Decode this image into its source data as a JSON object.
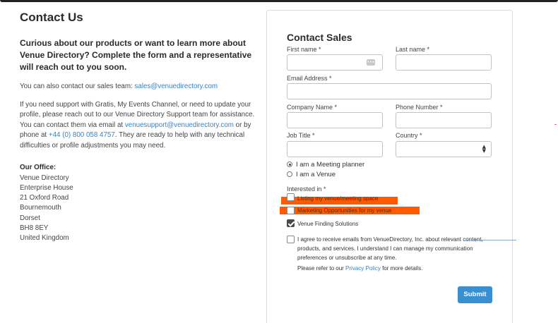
{
  "left": {
    "title": "Contact Us",
    "lead": "Curious about our products or want to learn more about Venue Directory? Complete the form and a representative will reach out to you soon.",
    "sales_prefix": "You can also contact our sales team: ",
    "sales_email": "sales@venuedirectory.com",
    "support_text_1": "If you need support with Gratis, My Events Channel, or need to update your profile, please reach out to our Venue Directory Support team for assistance. You can contact them via email at ",
    "support_email": "venuesupport@venuedirectory.com",
    "support_text_2": " or by phone at ",
    "support_phone": "+44 (0) 800 058 4757",
    "support_text_3": ". They are ready to help with any technical difficulties or profile adjustments you may need.",
    "office_title": "Our Office:",
    "office_lines": [
      "Venue Directory",
      "Enterprise House",
      "21 Oxford Road",
      "Bournemouth",
      "Dorset",
      "BH8 8EY",
      "United Kingdom"
    ]
  },
  "form": {
    "title": "Contact Sales",
    "first_name_label": "First name *",
    "first_name_value": "",
    "last_name_label": "Last name *",
    "last_name_value": "",
    "email_label": "Email Address *",
    "email_value": "",
    "company_label": "Company Name *",
    "company_value": "",
    "phone_label": "Phone Number *",
    "phone_value": "",
    "job_label": "Job Title *",
    "job_value": "",
    "country_label": "Country *",
    "country_value": "",
    "radio_planner": "I am a Meeting planner",
    "radio_venue": "I am a Venue",
    "interested_label": "Interested in *",
    "interest_1": "Listing my venue/meeting space",
    "interest_2": "Marketing Opportunities for my venue",
    "interest_3": "Venue Finding Solutions",
    "consent_text": "I agree to receive emails from VenueDirectory, Inc. about relevant content, products, and services. I understand I can manage my communication preferences or unsubscribe at any time.",
    "privacy_prefix": "Please refer to our ",
    "privacy_link": "Privacy Policy",
    "privacy_suffix": " for more details.",
    "submit_label": "Submit"
  },
  "colors": {
    "accent": "#3a8fd0",
    "link": "#3a82c4",
    "highlight": "#ff5a00"
  }
}
